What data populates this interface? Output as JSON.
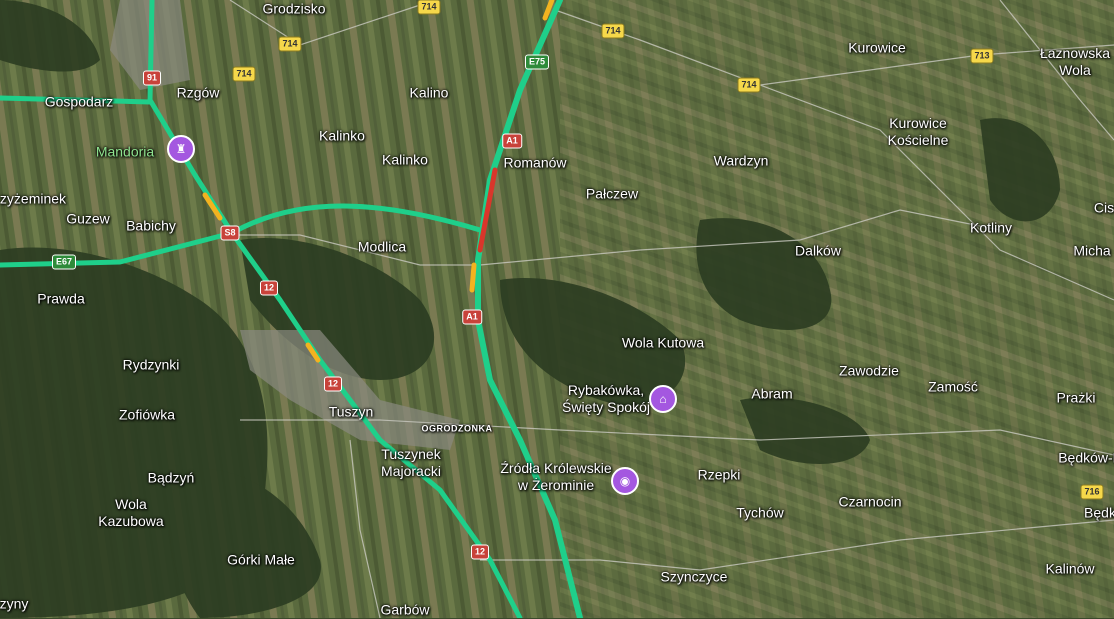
{
  "places": [
    {
      "name": "Grodzisko"
    },
    {
      "name": "Gospodarz"
    },
    {
      "name": "Rzgów"
    },
    {
      "name": "Kalino"
    },
    {
      "name": "Kalinko"
    },
    {
      "name": "Kalinko"
    },
    {
      "name": "Romanów"
    },
    {
      "name": "Pałczew"
    },
    {
      "name": "Wardzyn"
    },
    {
      "name": "Kurowice"
    },
    {
      "name": "Łaznowska\nWola"
    },
    {
      "name": "Kurowice\nKościelne"
    },
    {
      "name": "Kotliny"
    },
    {
      "name": "Cis"
    },
    {
      "name": "Micha"
    },
    {
      "name": "Dalków"
    },
    {
      "name": "Modlica"
    },
    {
      "name": "Babichy"
    },
    {
      "name": "Guzew"
    },
    {
      "name": "zyżeminek"
    },
    {
      "name": "Prawda"
    },
    {
      "name": "Rydzynki"
    },
    {
      "name": "Zofiówka"
    },
    {
      "name": "Tuszyn"
    },
    {
      "name": "Tuszynek\nMajoracki"
    },
    {
      "name": "Bądzyń"
    },
    {
      "name": "Wola\nKazubowa"
    },
    {
      "name": "Górki Małe"
    },
    {
      "name": "zyny"
    },
    {
      "name": "Garbów"
    },
    {
      "name": "Wola Kutowa"
    },
    {
      "name": "Abram"
    },
    {
      "name": "Zawodzie"
    },
    {
      "name": "Zamość"
    },
    {
      "name": "Prażki"
    },
    {
      "name": "Rzepki"
    },
    {
      "name": "Tychów"
    },
    {
      "name": "Czarnocin"
    },
    {
      "name": "Będków-Ko"
    },
    {
      "name": "Będk"
    },
    {
      "name": "Kalinów"
    },
    {
      "name": "Szynczyce"
    }
  ],
  "small_labels": [
    {
      "name": "OGRODZONKA"
    }
  ],
  "poi_labels": [
    {
      "name": "Mandoria",
      "icon": "theme-park-icon"
    },
    {
      "name": "Rybakówka,\nŚwięty Spokój",
      "icon": "lodging-icon"
    },
    {
      "name": "Źródła Królewskie\nw Żerominie",
      "icon": "camera-icon"
    }
  ],
  "shields": [
    {
      "text": "714",
      "color": "yellow"
    },
    {
      "text": "714",
      "color": "yellow"
    },
    {
      "text": "714",
      "color": "yellow"
    },
    {
      "text": "714",
      "color": "yellow"
    },
    {
      "text": "714",
      "color": "yellow"
    },
    {
      "text": "713",
      "color": "yellow"
    },
    {
      "text": "716",
      "color": "yellow"
    },
    {
      "text": "91",
      "color": "red"
    },
    {
      "text": "S8",
      "color": "red"
    },
    {
      "text": "12",
      "color": "red"
    },
    {
      "text": "12",
      "color": "red"
    },
    {
      "text": "12",
      "color": "red"
    },
    {
      "text": "A1",
      "color": "red"
    },
    {
      "text": "A1",
      "color": "red"
    },
    {
      "text": "E75",
      "color": "green"
    },
    {
      "text": "E67",
      "color": "green"
    }
  ],
  "colors": {
    "traffic_clear": "#1fcf8a",
    "traffic_slow": "#f2b320",
    "traffic_jam": "#d9362b",
    "poi": "#a457e0"
  }
}
